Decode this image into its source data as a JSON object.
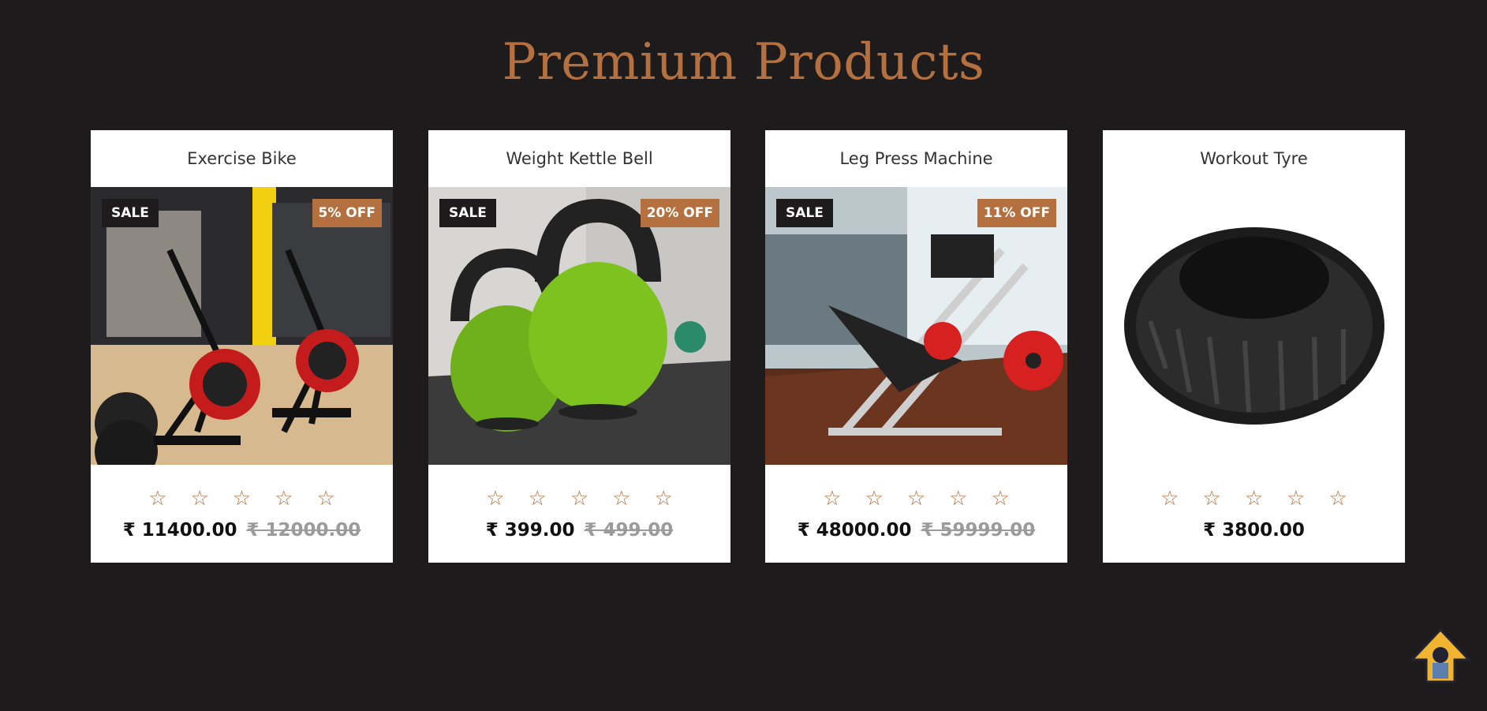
{
  "section": {
    "title": "Premium Products"
  },
  "products": [
    {
      "name": "Exercise Bike",
      "sale": "SALE",
      "discount": "5% OFF",
      "price": "₹ 11400.00",
      "old_price": "₹ 12000.00",
      "rating_icons": [
        "star-outline",
        "star-outline",
        "star-outline",
        "star-outline",
        "star-outline"
      ]
    },
    {
      "name": "Weight Kettle Bell",
      "sale": "SALE",
      "discount": "20% OFF",
      "price": "₹ 399.00",
      "old_price": "₹ 499.00",
      "rating_icons": [
        "star-outline",
        "star-outline",
        "star-outline",
        "star-outline",
        "star-outline"
      ]
    },
    {
      "name": "Leg Press Machine",
      "sale": "SALE",
      "discount": "11% OFF",
      "price": "₹ 48000.00",
      "old_price": "₹ 59999.00",
      "rating_icons": [
        "star-outline",
        "star-outline",
        "star-outline",
        "star-outline",
        "star-outline"
      ]
    },
    {
      "name": "Workout Tyre",
      "price": "₹ 3800.00",
      "rating_icons": [
        "star-outline",
        "star-outline",
        "star-outline",
        "star-outline",
        "star-outline"
      ]
    }
  ],
  "colors": {
    "background": "#1e1b1c",
    "accent": "#b5703f",
    "card": "#ffffff"
  }
}
